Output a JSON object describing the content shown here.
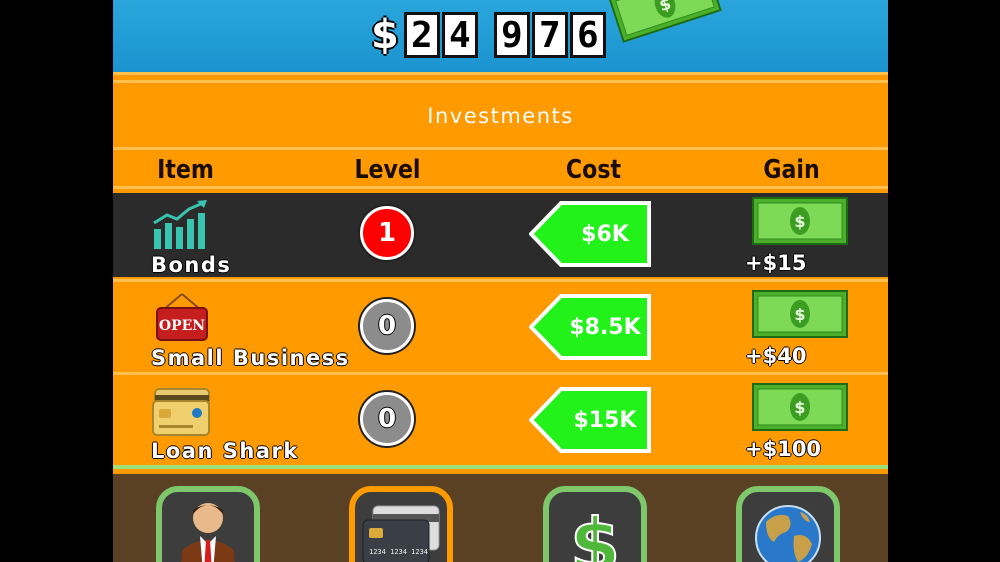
{
  "money": {
    "currency": "$",
    "digits": [
      "2",
      "4",
      "9",
      "7",
      "6"
    ],
    "value": 24976
  },
  "panel": {
    "title": "Investments",
    "headers": {
      "item": "Item",
      "level": "Level",
      "cost": "Cost",
      "gain": "Gain"
    }
  },
  "investments": [
    {
      "name": "Bonds",
      "icon": "chart-growth-icon",
      "level": "1",
      "cost": "$6K",
      "gain": "+$15"
    },
    {
      "name": "Small Business",
      "icon": "open-sign-icon",
      "level": "0",
      "cost": "$8.5K",
      "gain": "+$40"
    },
    {
      "name": "Loan Shark",
      "icon": "credit-cards-icon",
      "level": "0",
      "cost": "$15K",
      "gain": "+$100"
    }
  ],
  "nav": [
    {
      "icon": "businessman-icon",
      "active": false
    },
    {
      "icon": "credit-cards-icon",
      "active": true
    },
    {
      "icon": "dollar-sign-icon",
      "active": false
    },
    {
      "icon": "globe-icon",
      "active": false
    }
  ],
  "colors": {
    "sky": "#1b93cf",
    "panel": "#ff9a00",
    "selected_row": "#2b2b2b",
    "cost_tag": "#22f21a",
    "level_active": "#ff0000",
    "level_inactive": "#8c8c8c",
    "nav_bar": "#5a4124",
    "nav_border": "#7ec86b"
  }
}
